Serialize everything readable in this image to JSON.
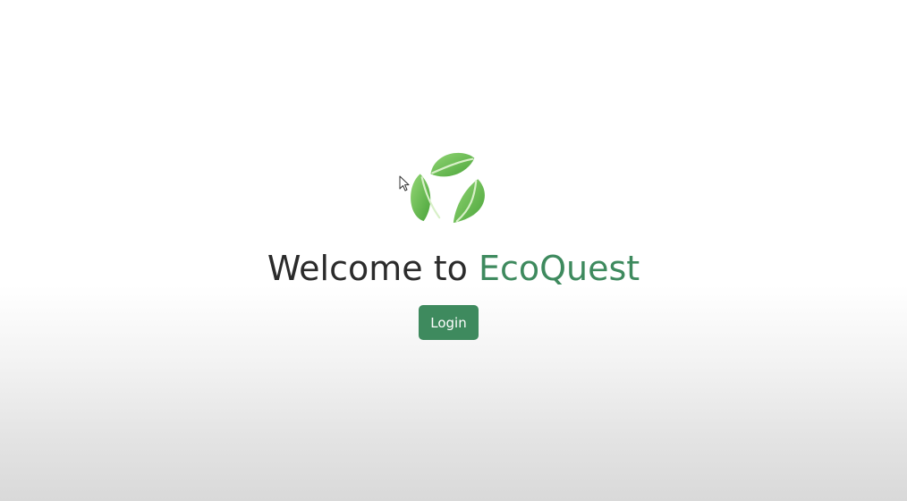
{
  "welcome": {
    "prefix": "Welcome to ",
    "brand": "EcoQuest"
  },
  "login_button": {
    "label": "Login"
  },
  "colors": {
    "brand_green": "#3e8a5e",
    "leaf_light": "#8fd36f",
    "leaf_dark": "#4ea83b",
    "text_dark": "#2b2b2b"
  },
  "icons": {
    "logo": "recycle-leaves-icon",
    "cursor": "mouse-pointer-icon"
  }
}
